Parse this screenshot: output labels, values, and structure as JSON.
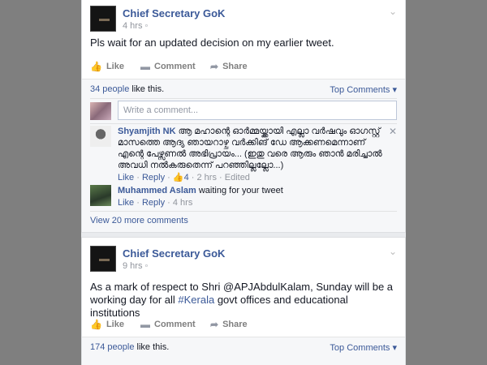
{
  "colors": {
    "link": "#3b5998",
    "muted": "#90949c",
    "sidebar": "#7f7f7f"
  },
  "post1": {
    "page_name": "Chief Secretary GoK",
    "time": "4 hrs",
    "text": "Pls wait for an updated decision on my earlier tweet.",
    "actions": {
      "like": "Like",
      "comment": "Comment",
      "share": "Share"
    },
    "likes": {
      "count_text": "34 people",
      "rest": " like this."
    },
    "top_comments": "Top Comments",
    "comment_placeholder": "Write a comment...",
    "comments": [
      {
        "author": "Shyamjith NK",
        "text": "ആ മഹാന്റെ ഓർമ്മയ്ക്കായി എല്ലാ വർഷവും ഓഗസ്റ്റ് മാസത്തെ ആദ്യ ഞായറാഴ്ച വർക്കിങ് ഡേ ആക്കണമെന്നാണ് എന്റെ പേഴ്സണൽ അഭിപ്രായം... (ഇതു വരെ ആരും ഞാൻ മരിച്ചാൽ അവധി നൽകരുതെന്ന് പറഞ്ഞില്ലല്ലോ...)",
        "like": "Like",
        "reply": "Reply",
        "like_count": "4",
        "time": "2 hrs",
        "edited": "Edited"
      },
      {
        "author": "Muhammed Aslam",
        "text": "waiting for your tweet",
        "like": "Like",
        "reply": "Reply",
        "time": "4 hrs"
      }
    ],
    "view_more": "View 20 more comments"
  },
  "post2": {
    "page_name": "Chief Secretary GoK",
    "time": "9 hrs",
    "text_before": "As a mark of respect to Shri @APJAbdulKalam, Sunday will be a working day for all ",
    "hashtag": "#Kerala",
    "text_after": " govt offices and educational institutions",
    "actions": {
      "like": "Like",
      "comment": "Comment",
      "share": "Share"
    },
    "likes": {
      "count_text": "174 people",
      "rest": " like this."
    },
    "top_comments": "Top Comments"
  }
}
